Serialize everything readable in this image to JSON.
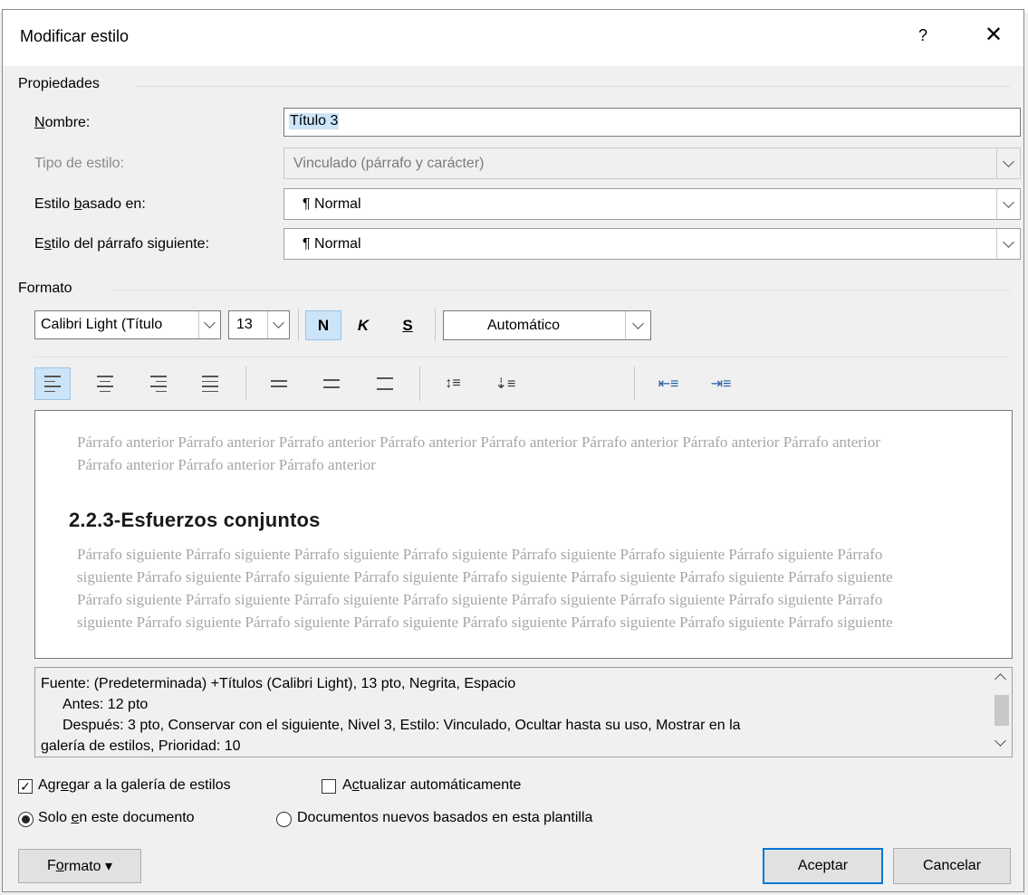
{
  "dialog": {
    "title": "Modificar estilo",
    "help_label": "?",
    "close_label": "✕"
  },
  "properties": {
    "group_label": "Propiedades",
    "name_label_u": "N",
    "name_label_rest": "ombre:",
    "name_value": "Título 3",
    "style_type_label": "Tipo de estilo:",
    "style_type_value": "Vinculado (párrafo y carácter)",
    "based_on_label_pre": "Estilo ",
    "based_on_label_u": "b",
    "based_on_label_rest": "asado en:",
    "based_on_value": "¶  Normal",
    "next_style_label_pre": "E",
    "next_style_label_u": "s",
    "next_style_label_rest": "tilo del párrafo siguiente:",
    "next_style_value": "¶  Normal"
  },
  "format": {
    "group_label": "Formato",
    "font_name": "Calibri Light (Título",
    "font_size": "13",
    "bold_label": "N",
    "italic_label": "K",
    "underline_label": "S",
    "color_value": "Automático"
  },
  "preview": {
    "previous_text": "Párrafo anterior Párrafo anterior Párrafo anterior Párrafo anterior Párrafo anterior Párrafo anterior Párrafo anterior Párrafo anterior Párrafo anterior Párrafo anterior Párrafo anterior",
    "heading": "2.2.3-Esfuerzos conjuntos",
    "next_text": "Párrafo siguiente Párrafo siguiente Párrafo siguiente Párrafo siguiente Párrafo siguiente Párrafo siguiente Párrafo siguiente Párrafo siguiente Párrafo siguiente Párrafo siguiente Párrafo siguiente Párrafo siguiente Párrafo siguiente Párrafo siguiente Párrafo siguiente Párrafo siguiente Párrafo siguiente Párrafo siguiente Párrafo siguiente Párrafo siguiente Párrafo siguiente Párrafo siguiente Párrafo siguiente Párrafo siguiente Párrafo siguiente Párrafo siguiente Párrafo siguiente Párrafo siguiente Párrafo siguiente Párrafo siguiente"
  },
  "description": {
    "line1": "Fuente: (Predeterminada) +Títulos (Calibri Light), 13 pto, Negrita, Espacio",
    "line2": "Antes:  12 pto",
    "line3": "Después:  3 pto, Conservar con el siguiente, Nivel 3, Estilo: Vinculado, Ocultar hasta su uso, Mostrar en la",
    "line4": "galería de estilos, Prioridad: 10"
  },
  "options": {
    "add_gallery_pre": "Agr",
    "add_gallery_u": "e",
    "add_gallery_rest": "gar a la galería de estilos",
    "add_gallery_checked": true,
    "auto_update_pre": "A",
    "auto_update_u": "c",
    "auto_update_rest": "tualizar automáticamente",
    "auto_update_checked": false,
    "only_doc_pre": "Solo ",
    "only_doc_u": "e",
    "only_doc_rest": "n este documento",
    "new_docs_label": "Documentos nuevos basados en esta plantilla"
  },
  "buttons": {
    "format_pre": "F",
    "format_u": "o",
    "format_rest": "rmato ▾",
    "accept": "Aceptar",
    "cancel": "Cancelar"
  },
  "colors": {
    "accent": "#0078d7",
    "selection": "#cce4f7"
  }
}
